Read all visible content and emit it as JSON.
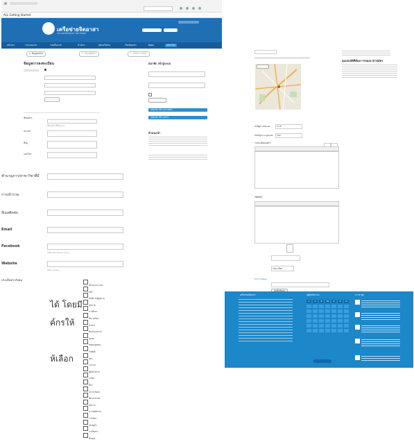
{
  "browser": {
    "address": "http://... /regist/",
    "bookmark": "ALL  Getting Started",
    "search_placeholder": "Search"
  },
  "site": {
    "logo_text": "เครือข่ายจิตอาสา",
    "logo_sub": "VOLUNTEERSPOT NETWORK",
    "nav": [
      "หน้าแรก",
      "รวมงานอาสา",
      "ร่วมเป็นอาสา",
      "ข่าวสาร",
      "รู้จักเครือข่าย",
      "เรื่องจิตอาสา",
      "ติดต่อ",
      "สมัครใหม่"
    ]
  },
  "steps": [
    "1. ข้อมูลองค์กร",
    "2. ข้อมูลผู้ติดต่อ",
    "3. ยืนยันการสมัคร"
  ],
  "panelA": {
    "form_title": "ข้อมูลการลงทะเบียน",
    "sidebar_title": "สมาชิก เข้าสู่ระบบ",
    "sidebar_buttons": [
      "สมัครสมาชิก อาสาสมัคร",
      "สมัครสมาชิก องค์กร"
    ],
    "sidebar_section": "คำแนะนำ",
    "fields": [
      {
        "label": "ชื่อองค์กร",
        "helper": "ชื่อองค์กรที่ต้องการ"
      },
      {
        "label": "ประเภท",
        "helper": ""
      },
      {
        "label": "ที่อยู่",
        "helper": ""
      },
      {
        "label": "เบอร์โทร",
        "helper": ""
      }
    ],
    "labels": [
      {
        "text": "ชำนาญการ/สาขาวิชาที่มี",
        "helper": ""
      },
      {
        "text": "การเข้าร่วม",
        "helper": ""
      },
      {
        "text": "อีเมลติดต่อ",
        "helper": ""
      },
      {
        "text": "Email",
        "helper": ""
      },
      {
        "text": "Facebook",
        "helper": "http://facebook.com/..."
      },
      {
        "text": "Website",
        "helper": "http://www..."
      },
      {
        "text": "ประเด็นทางสังคม",
        "helper": ""
      }
    ],
    "checkboxes": [
      "เด็กและเยาวชน",
      "สตรี",
      "คนพิการ/ผู้สูงอายุ",
      "สุขภาพ",
      "การศึกษา",
      "สิ่งแวดล้อม",
      "ศาสนา",
      "ศิลปวัฒนธรรม",
      "ชุมชน",
      "สิทธิมนุษยชน",
      "ภัยพิบัติ",
      "สัตว์",
      "แรงงาน",
      "ผู้ด้อยโอกาส",
      "เกษตร",
      "อื่นๆ",
      "ประชาสังคม",
      "พัฒนาชนบท",
      "สุขภาวะ",
      "ความยุติธรรม",
      "การเมือง",
      "เศรษฐกิจ",
      "การสื่อสาร",
      "ทั้งหมด"
    ]
  },
  "thai_cutoff": [
    "ได้ โดยมี",
    "ค์กรให้",
    "ห้เลือก"
  ],
  "panelB": {
    "top_right_heading": "คุณสมบัติที่ต้องการของอาสาสมัคร",
    "latitude_label": "ละติจูด Latitude",
    "latitude": "13.8",
    "longitude_label": "ลองจิจูด Longitude",
    "longitude": "100",
    "editor1_label": "รายละเอียดองค์กร",
    "editor2_label": "วิสัยทัศน์",
    "select_value": "กรุณาเลือก",
    "upload_label": "Edit Images",
    "button": "บันทึกข้อมูล"
  },
  "panelC": {
    "col1_title": "เครือข่ายจิตอาสา",
    "col2_title": "ปฏิทินกิจกรรม",
    "col3_title": "ข่าวล่าสุด",
    "cal_days": [
      "จ",
      "อ",
      "พ",
      "พฤ",
      "ศ",
      "ส",
      "อา"
    ]
  },
  "colors": {
    "primary": "#1f6fb5",
    "nav": "#165c9a",
    "button": "#2a8fd3",
    "footer": "#1c87c9"
  }
}
